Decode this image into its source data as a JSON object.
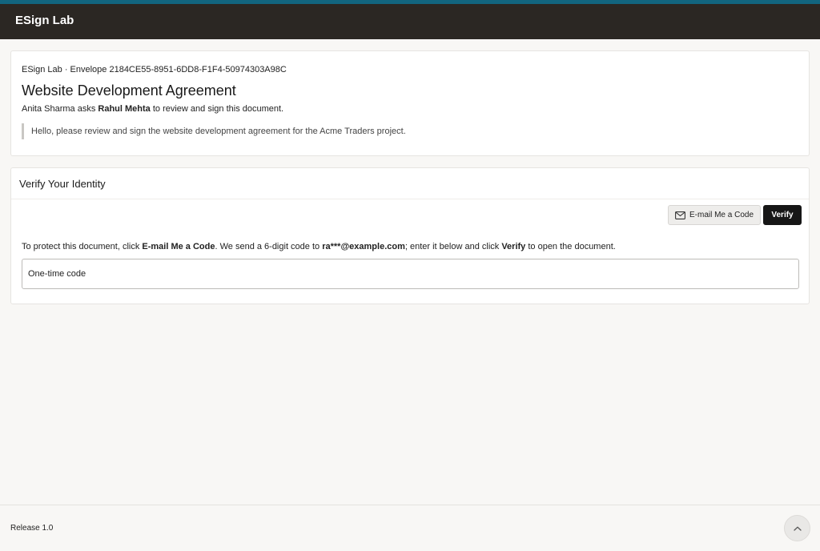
{
  "header": {
    "brand": "ESign Lab"
  },
  "document": {
    "meta": "ESign Lab · Envelope 2184CE55-8951-6DD8-F1F4-50974303A98C",
    "title": "Website Development Agreement",
    "sender": "Anita Sharma",
    "request_verb": " asks ",
    "recipient": "Rahul Mehta",
    "request_tail": " to review and sign this document.",
    "message": "Hello, please review and sign the website development agreement for the Acme Traders project."
  },
  "verify": {
    "title": "Verify Your Identity",
    "email_button_label": "E-mail Me a Code",
    "email_button_icon": "mail-icon",
    "verify_button_label": "Verify",
    "instructions": {
      "part1": "To protect this document, click ",
      "bold1": "E-mail Me a Code",
      "part2": ". We send a 6-digit code to ",
      "bold2": "ra***@example.com",
      "part3": "; enter it below and click ",
      "bold3": "Verify",
      "part4": " to open the document."
    },
    "code_input": {
      "value": "",
      "placeholder": "One-time code"
    }
  },
  "footer": {
    "release": "Release 1.0",
    "scroll_top_icon": "chevron-up-icon"
  },
  "colors": {
    "topbar": "#2b2723",
    "topbar_accent": "#12657f",
    "primary_button": "#161616",
    "background": "#f8f7f5"
  }
}
